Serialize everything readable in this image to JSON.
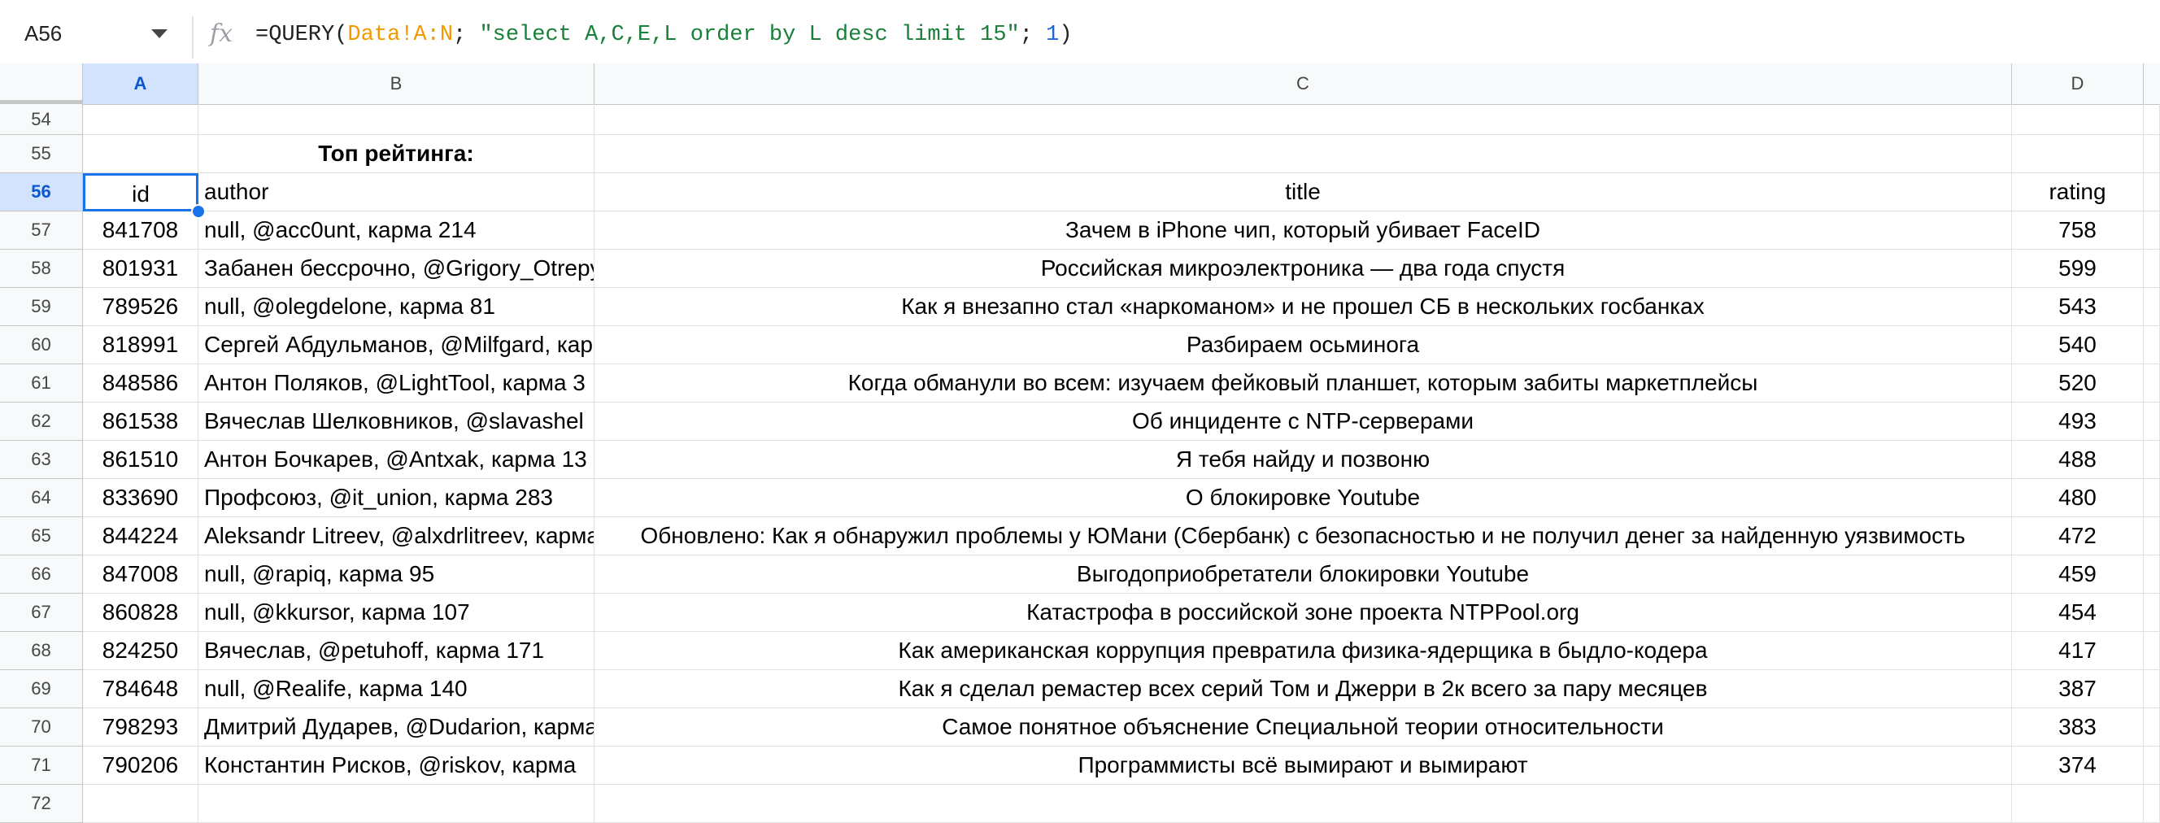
{
  "formula_bar": {
    "name_box": "A56",
    "fx_label": "fx",
    "formula_prefix": "=QUERY(",
    "formula_range": "Data!A:N",
    "formula_sep1": "; ",
    "formula_string": "\"select A,C,E,L order by L desc limit 15\"",
    "formula_sep2": "; ",
    "formula_number": "1",
    "formula_suffix": ")"
  },
  "columns": [
    {
      "label": "A",
      "active": true
    },
    {
      "label": "B",
      "active": false
    },
    {
      "label": "C",
      "active": false
    },
    {
      "label": "D",
      "active": false
    }
  ],
  "rows": [
    {
      "num": "54",
      "a": "",
      "b": "",
      "c": "",
      "d": ""
    },
    {
      "num": "55",
      "a": "",
      "b": "Топ рейтинга:",
      "c": "",
      "d": ""
    },
    {
      "num": "56",
      "a": "id",
      "b": "author",
      "c": "title",
      "d": "rating"
    },
    {
      "num": "57",
      "a": "841708",
      "b": "null, @acc0unt, карма 214",
      "c": "Зачем в iPhone чип, который убивает FaceID",
      "d": "758"
    },
    {
      "num": "58",
      "a": "801931",
      "b": "Забанен бессрочно, @Grigory_Otrepyev, карма",
      "c": "Российская микроэлектроника — два года спустя",
      "d": "599"
    },
    {
      "num": "59",
      "a": "789526",
      "b": "null, @olegdelone, карма 81",
      "c": "Как я внезапно стал «наркоманом» и не прошел СБ в нескольких госбанках",
      "d": "543"
    },
    {
      "num": "60",
      "a": "818991",
      "b": "Сергей Абдульманов, @Milfgard, карма",
      "c": "Разбираем осьминога",
      "d": "540"
    },
    {
      "num": "61",
      "a": "848586",
      "b": "Антон Поляков, @LightTool, карма 3",
      "c": "Когда обманули во всем: изучаем фейковый планшет, которым забиты маркетплейсы",
      "d": "520"
    },
    {
      "num": "62",
      "a": "861538",
      "b": "Вячеслав Шелковников, @slavashel",
      "c": "Об инциденте с NTP-серверами",
      "d": "493"
    },
    {
      "num": "63",
      "a": "861510",
      "b": "Антон Бочкарев, @Antxak, карма 13",
      "c": "Я тебя найду и позвоню",
      "d": "488"
    },
    {
      "num": "64",
      "a": "833690",
      "b": "Профсоюз, @it_union, карма 283",
      "c": "О блокировке Youtube",
      "d": "480"
    },
    {
      "num": "65",
      "a": "844224",
      "b": "Aleksandr Litreev, @alxdrlitreev, карма",
      "c": "Обновлено: Как я обнаружил проблемы у ЮМани (Сбербанк) с безопасностью и не получил денег за найденную уязвимость",
      "d": "472"
    },
    {
      "num": "66",
      "a": "847008",
      "b": "null, @rapiq, карма 95",
      "c": "Выгодоприобретатели блокировки Youtube",
      "d": "459"
    },
    {
      "num": "67",
      "a": "860828",
      "b": "null, @kkursor, карма 107",
      "c": "Катастрофа в российской зоне проекта NTPPool.org",
      "d": "454"
    },
    {
      "num": "68",
      "a": "824250",
      "b": "Вячеслав, @petuhoff, карма 171",
      "c": "Как американская коррупция превратила физика-ядерщика в быдло-кодера",
      "d": "417"
    },
    {
      "num": "69",
      "a": "784648",
      "b": "null, @Realife, карма 140",
      "c": "Как я сделал ремастер всех серий Том и Джерри в 2к всего за пару месяцев",
      "d": "387"
    },
    {
      "num": "70",
      "a": "798293",
      "b": "Дмитрий Дударев, @Dudarion, карма",
      "c": "Самое понятное объяснение Специальной теории относительности",
      "d": "383"
    },
    {
      "num": "71",
      "a": "790206",
      "b": "Константин Рисков, @riskov, карма",
      "c": "Программисты всё вымирают и вымирают",
      "d": "374"
    },
    {
      "num": "72",
      "a": "",
      "b": "",
      "c": "",
      "d": ""
    }
  ]
}
